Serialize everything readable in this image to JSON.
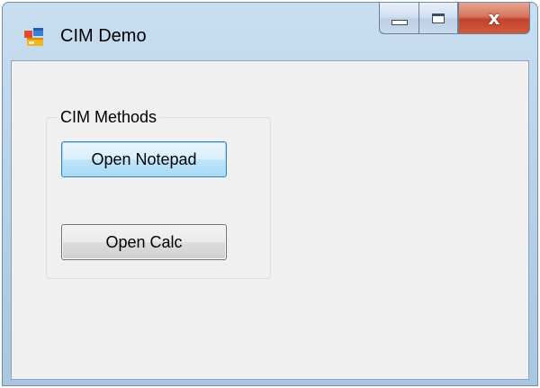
{
  "window": {
    "title": "CIM Demo",
    "app_icon": "winforms-app-icon",
    "caption_buttons": {
      "minimize_icon": "minimize-icon",
      "maximize_icon": "maximize-icon",
      "close_glyph": "x"
    }
  },
  "group": {
    "label": "CIM Methods"
  },
  "buttons": {
    "open_notepad": "Open Notepad",
    "open_calc": "Open Calc"
  },
  "colors": {
    "client_background": "#f0f0f0",
    "close_button": "#c2432a",
    "focused_button_border": "#3c7fb1"
  }
}
